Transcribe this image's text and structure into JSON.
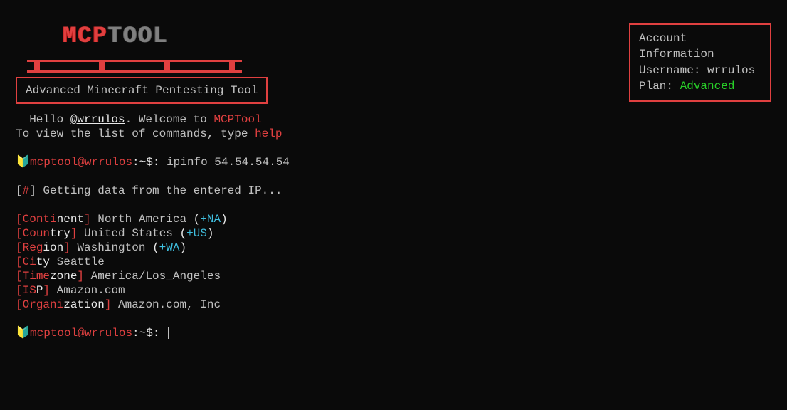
{
  "logo": {
    "part1": "MCP",
    "part2": "TOOL"
  },
  "subtitle": "Advanced Minecraft Pentesting Tool",
  "account": {
    "header": "Account Information",
    "username_label": "Username:",
    "username": "wrrulos",
    "plan_label": "Plan:",
    "plan": "Advanced"
  },
  "welcome": {
    "hello": "Hello ",
    "handle": "@wrrulos",
    "hello2": ". Welcome to ",
    "tool_name": "MCPTool",
    "help_line_prefix": "To view the list of commands, type ",
    "help_cmd": "help"
  },
  "prompt": {
    "user": "mcptool",
    "at": "@",
    "host": "wrrulos",
    "tail": ":~$:",
    "command": "ipinfo 54.54.54.54"
  },
  "status": {
    "bracket_open": "[",
    "hash": "#",
    "bracket_close": "]",
    "text": " Getting data from the entered IP..."
  },
  "ipinfo": {
    "continent_label_pre": "Conti",
    "continent_label_post": "nent",
    "continent_value": " North America ",
    "continent_code": "+NA",
    "country_label_pre": "Coun",
    "country_label_post": "try",
    "country_value": " United States ",
    "country_code": "+US",
    "region_label_pre": "Reg",
    "region_label_post": "ion",
    "region_value": " Washington ",
    "region_code": "+WA",
    "city_label_pre": "Ci",
    "city_label_post": "ty",
    "city_value": " Seattle",
    "timezone_label_pre": "Time",
    "timezone_label_post": "zone",
    "timezone_value": " America/Los_Angeles",
    "isp_label_pre": "IS",
    "isp_label_post": "P",
    "isp_value": " Amazon.com",
    "org_label_pre": "Organi",
    "org_label_post": "zation",
    "org_value": " Amazon.com, Inc"
  },
  "glyphs": {
    "open_bracket": "[",
    "close_bracket": "]",
    "open_paren": "(",
    "close_paren": ")",
    "prompt_icon": "🔰"
  }
}
